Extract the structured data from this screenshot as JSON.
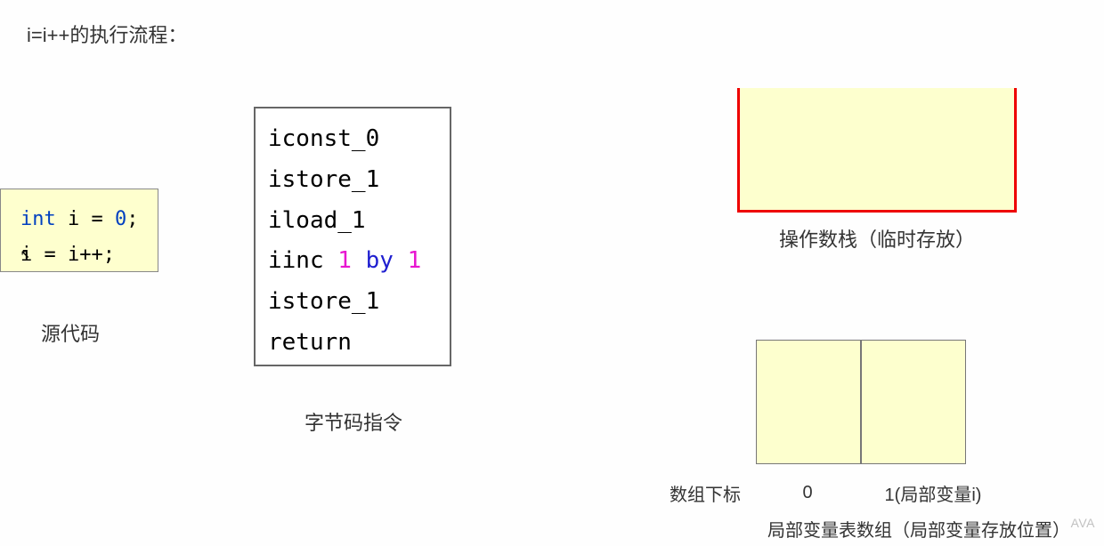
{
  "title": "i=i++的执行流程：",
  "source": {
    "line1_kw": "int",
    "line1_rest": " i = ",
    "line1_num": "0",
    "line1_end": ";",
    "line2": "i = i++;",
    "label": "源代码"
  },
  "bytecode": {
    "lines": {
      "l1": "iconst_0",
      "l2": "istore_1",
      "l3": "iload_1",
      "l4_op": "iinc ",
      "l4_a": "1",
      "l4_by": " by ",
      "l4_b": "1",
      "l5": "istore_1",
      "l6": "return"
    },
    "label": "字节码指令"
  },
  "stack": {
    "label": "操作数栈（临时存放）"
  },
  "lvt": {
    "index_label": "数组下标",
    "idx0": "0",
    "idx1": "1(局部变量i)",
    "label": "局部变量表数组（局部变量存放位置）"
  },
  "watermark": "AVA"
}
